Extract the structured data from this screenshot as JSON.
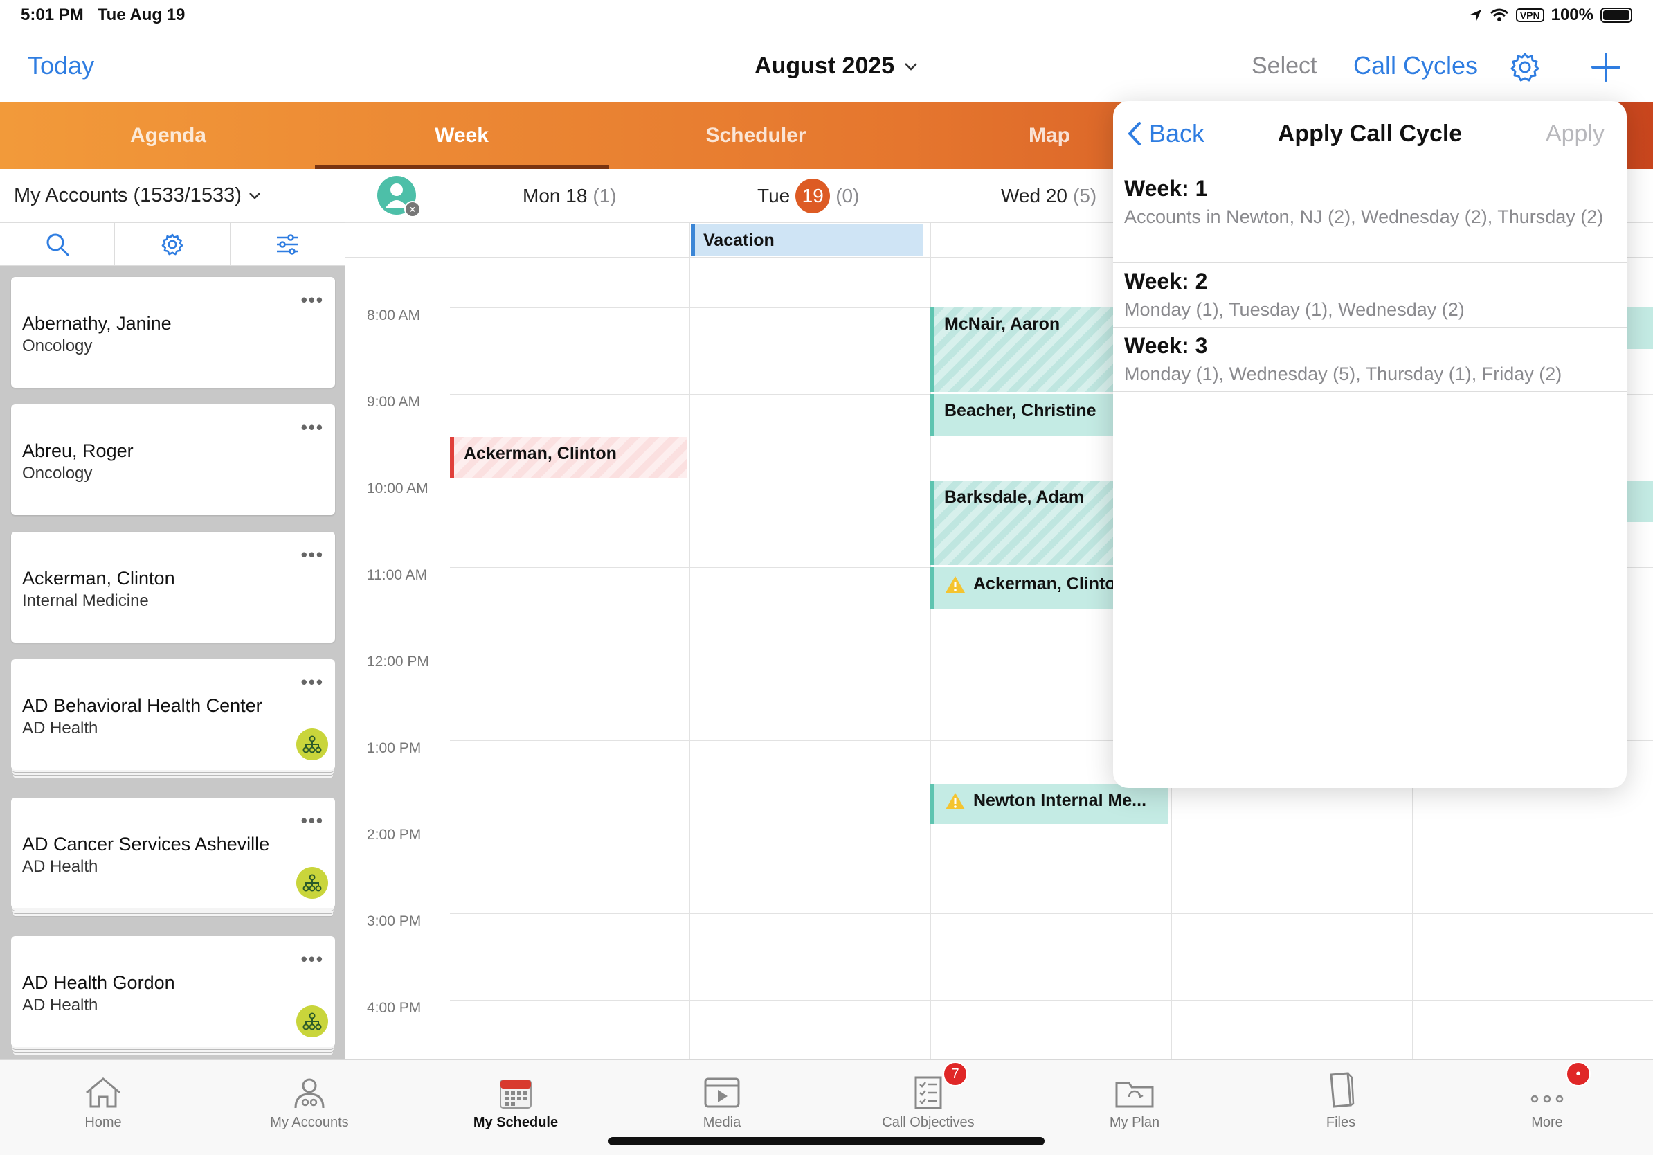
{
  "status": {
    "time": "5:01 PM",
    "date": "Tue Aug 19",
    "vpn": "VPN",
    "battery": "100%"
  },
  "nav": {
    "today": "Today",
    "month": "August 2025",
    "select": "Select",
    "call_cycles": "Call Cycles"
  },
  "tabs": [
    {
      "label": "Agenda"
    },
    {
      "label": "Week"
    },
    {
      "label": "Scheduler"
    },
    {
      "label": "Map"
    }
  ],
  "left": {
    "header": "My Accounts (1533/1533)",
    "accounts": [
      {
        "name": "Abernathy, Janine",
        "sub": "Oncology"
      },
      {
        "name": "Abreu, Roger",
        "sub": "Oncology"
      },
      {
        "name": "Ackerman, Clinton",
        "sub": "Internal Medicine"
      },
      {
        "name": "AD Behavioral Health Center",
        "sub": "AD Health"
      },
      {
        "name": "AD Cancer Services Asheville",
        "sub": "AD Health"
      },
      {
        "name": "AD Health Gordon",
        "sub": "AD Health"
      }
    ]
  },
  "calendar": {
    "days": [
      {
        "label": "Mon 18",
        "count": "(1)"
      },
      {
        "label": "Tue",
        "num": "19",
        "count": "(0)"
      },
      {
        "label": "Wed 20",
        "count": "(5)"
      }
    ],
    "allday_event": "Vacation",
    "times": [
      "8:00 AM",
      "9:00 AM",
      "10:00 AM",
      "11:00 AM",
      "12:00 PM",
      "1:00 PM",
      "2:00 PM",
      "3:00 PM",
      "4:00 PM"
    ],
    "events": [
      {
        "title": "McNair, Aaron"
      },
      {
        "title": "Beacher, Christine"
      },
      {
        "title": "Ackerman, Clinton"
      },
      {
        "title": "Barksdale, Adam"
      },
      {
        "title": "Ackerman, Clinto"
      },
      {
        "title": "Newton Internal Me..."
      }
    ]
  },
  "popover": {
    "back": "Back",
    "title": "Apply Call Cycle",
    "apply": "Apply",
    "weeks": [
      {
        "title": "Week: 1",
        "desc": "Accounts in Newton, NJ (2), Wednesday (2), Thursday (2)"
      },
      {
        "title": "Week: 2",
        "desc": "Monday (1), Tuesday (1), Wednesday (2)"
      },
      {
        "title": "Week: 3",
        "desc": "Monday (1), Wednesday (5), Thursday (1), Friday (2)"
      }
    ]
  },
  "bottom_tabs": [
    {
      "label": "Home",
      "icon": "home-icon"
    },
    {
      "label": "My Accounts",
      "icon": "accounts-icon"
    },
    {
      "label": "My Schedule",
      "icon": "calendar-icon"
    },
    {
      "label": "Media",
      "icon": "media-icon"
    },
    {
      "label": "Call Objectives",
      "icon": "checklist-icon",
      "badge": "7"
    },
    {
      "label": "My Plan",
      "icon": "folder-icon"
    },
    {
      "label": "Files",
      "icon": "file-icon"
    },
    {
      "label": "More",
      "icon": "more-icon",
      "badge": "•"
    }
  ],
  "colors": {
    "accent": "#2f7de1",
    "orange": "#e5762e",
    "today": "#dd5b24",
    "teal": "#5ec4b0",
    "red": "#e0403a"
  }
}
